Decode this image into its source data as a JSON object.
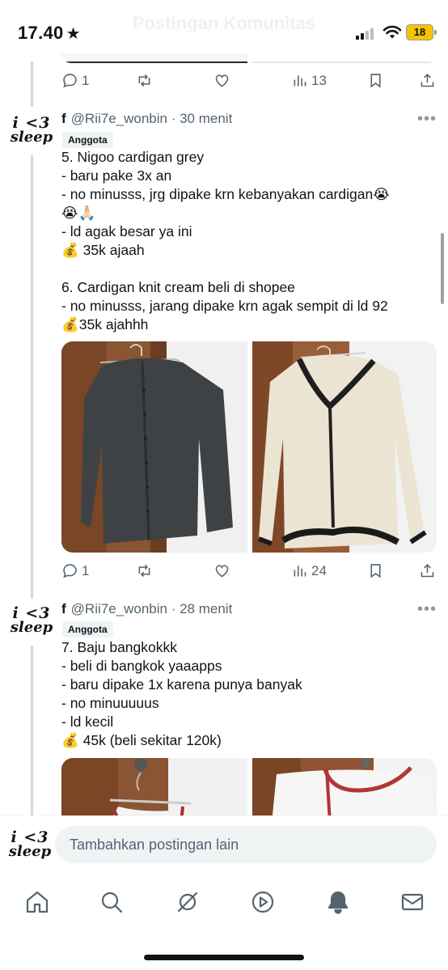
{
  "status_bar": {
    "time": "17.40",
    "star": "★",
    "battery": "18",
    "header_ghost_title": "Postingan Komunitas",
    "header_ghost_sub": ""
  },
  "top_actions": {
    "replies": "1",
    "views": "13"
  },
  "posts": [
    {
      "display_name": "f",
      "meta": "@Rii7e_wonbin · 30 menit",
      "badge": "Anggota",
      "text": "5. Nigoo cardigan grey\n- baru pake 3x an\n- no minusss, jrg dipake krn kebanyakan cardigan😭\n😭🙏🏻\n- ld agak besar ya ini\n💰 35k ajaah\n\n6. Cardigan knit cream beli di shopee\n- no minusss, jarang dipake krn agak sempit di ld 92\n💰35k ajahhh",
      "replies": "1",
      "views": "24"
    },
    {
      "display_name": "f",
      "meta": "@Rii7e_wonbin · 28 menit",
      "badge": "Anggota",
      "text": "7. Baju bangkokkk\n- beli di bangkok yaaapps\n- baru dipake 1x karena punya banyak\n- no minuuuuus\n- ld kecil\n💰 45k (beli sekitar 120k)"
    }
  ],
  "avatar": {
    "line1": "i <3",
    "line2": "sleep"
  },
  "more_glyph": "•••",
  "compose": {
    "placeholder": "Tambahkan postingan lain"
  },
  "icons": {
    "reply": "reply-icon",
    "repost": "repost-icon",
    "like": "heart-icon",
    "views": "views-icon",
    "bookmark": "bookmark-icon",
    "share": "share-icon"
  },
  "tabs": [
    "home",
    "search",
    "grok",
    "video",
    "notifications",
    "messages"
  ],
  "colors": {
    "text": "#0f1419",
    "muted": "#536471",
    "thread": "#cfd9de",
    "battery": "#f5c400"
  }
}
